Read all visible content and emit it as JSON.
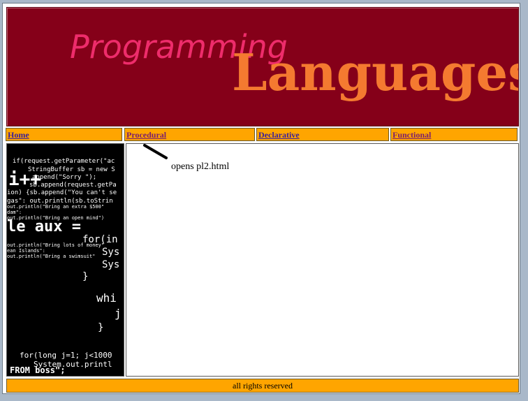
{
  "banner": {
    "word1": "Programming",
    "word2": "Languages",
    "colors": {
      "background": "#850019",
      "word1": "#ee2c6b",
      "word2": "#f47a30"
    }
  },
  "nav": {
    "items": [
      {
        "label": "Home"
      },
      {
        "label": "Procedural"
      },
      {
        "label": "Declarative"
      },
      {
        "label": "Functional"
      }
    ]
  },
  "sidebar": {
    "code_lines": [
      "if(request.getParameter(\"ac",
      "StringBuffer sb = new S",
      "append(\"Sorry \");",
      "sb.append(request.getPa",
      "ion) {sb.append(\"You can't se",
      "gas\": out.println(sb.toStrin",
      "out.println(\"Bring an extra $500\"",
      "dam\":",
      "out.println(\"Bring an open mind\")",
      "i++",
      "le aux =",
      "out.println(\"Bring lots of money\"",
      "ean Islands\":",
      "out.println(\"Bring a swimsuit\"",
      "for(in",
      "Sys",
      "Sys",
      "}",
      "whi",
      "j",
      "}",
      "for(long j=1; j<1000",
      "System.out.printl",
      "FROM boss\";"
    ]
  },
  "main": {
    "note": "opens pl2.html"
  },
  "footer": {
    "text": "all rights reserved"
  }
}
